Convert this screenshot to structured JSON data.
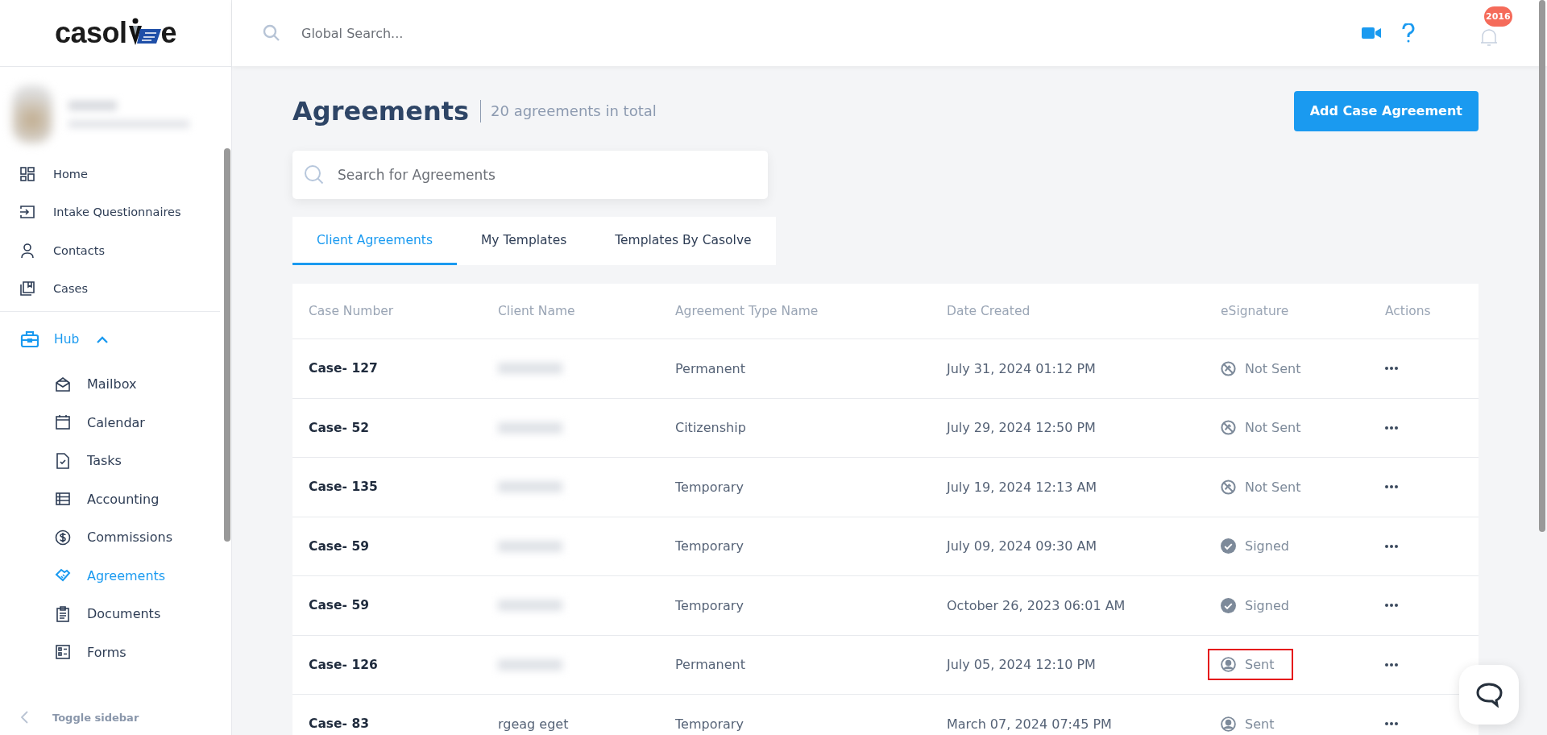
{
  "logo": {
    "before": "casol",
    "after": "e"
  },
  "header": {
    "search": {
      "placeholder": "Global Search..."
    },
    "notifications": {
      "badge": "2016"
    }
  },
  "sidebar": {
    "items": [
      {
        "label": "Home",
        "selected": false
      },
      {
        "label": "Intake Questionnaires",
        "selected": false
      },
      {
        "label": "Contacts",
        "selected": false
      },
      {
        "label": "Cases",
        "selected": false
      }
    ],
    "hub": {
      "label": "Hub",
      "expanded": true,
      "children": [
        {
          "label": "Mailbox",
          "selected": false
        },
        {
          "label": "Calendar",
          "selected": false
        },
        {
          "label": "Tasks",
          "selected": false
        },
        {
          "label": "Accounting",
          "selected": false
        },
        {
          "label": "Commissions",
          "selected": false
        },
        {
          "label": "Agreements",
          "selected": true
        },
        {
          "label": "Documents",
          "selected": false
        },
        {
          "label": "Forms",
          "selected": false
        }
      ]
    },
    "toggle": "Toggle sidebar"
  },
  "page": {
    "title": "Agreements",
    "subtitle": "20 agreements in total",
    "add_button": "Add Case Agreement",
    "search": {
      "placeholder": "Search for Agreements"
    }
  },
  "tabs": [
    {
      "label": "Client Agreements",
      "selected": true
    },
    {
      "label": "My Templates",
      "selected": false
    },
    {
      "label": "Templates By Casolve",
      "selected": false
    }
  ],
  "table": {
    "columns": [
      "Case Number",
      "Client Name",
      "Agreement Type Name",
      "Date Created",
      "eSignature",
      "Actions"
    ],
    "rows": [
      {
        "case": "Case- 127",
        "type": "Permanent",
        "date": "July 31, 2024 01:12 PM",
        "status": "Not Sent",
        "kind": "not_sent",
        "highlighted": false
      },
      {
        "case": "Case- 52",
        "type": "Citizenship",
        "date": "July 29, 2024 12:50 PM",
        "status": "Not Sent",
        "kind": "not_sent",
        "highlighted": false
      },
      {
        "case": "Case- 135",
        "type": "Temporary",
        "date": "July 19, 2024 12:13 AM",
        "status": "Not Sent",
        "kind": "not_sent",
        "highlighted": false
      },
      {
        "case": "Case- 59",
        "type": "Temporary",
        "date": "July 09, 2024 09:30 AM",
        "status": "Signed",
        "kind": "signed",
        "highlighted": false
      },
      {
        "case": "Case- 59",
        "type": "Temporary",
        "date": "October 26, 2023 06:01 AM",
        "status": "Signed",
        "kind": "signed",
        "highlighted": false
      },
      {
        "case": "Case- 126",
        "type": "Permanent",
        "date": "July 05, 2024 12:10 PM",
        "status": "Sent",
        "kind": "sent",
        "highlighted": true
      },
      {
        "case": "Case- 83",
        "client": "rgeag eget",
        "type": "Temporary",
        "date": "March 07, 2024 07:45 PM",
        "status": "Sent",
        "kind": "sent",
        "highlighted": false
      }
    ]
  }
}
